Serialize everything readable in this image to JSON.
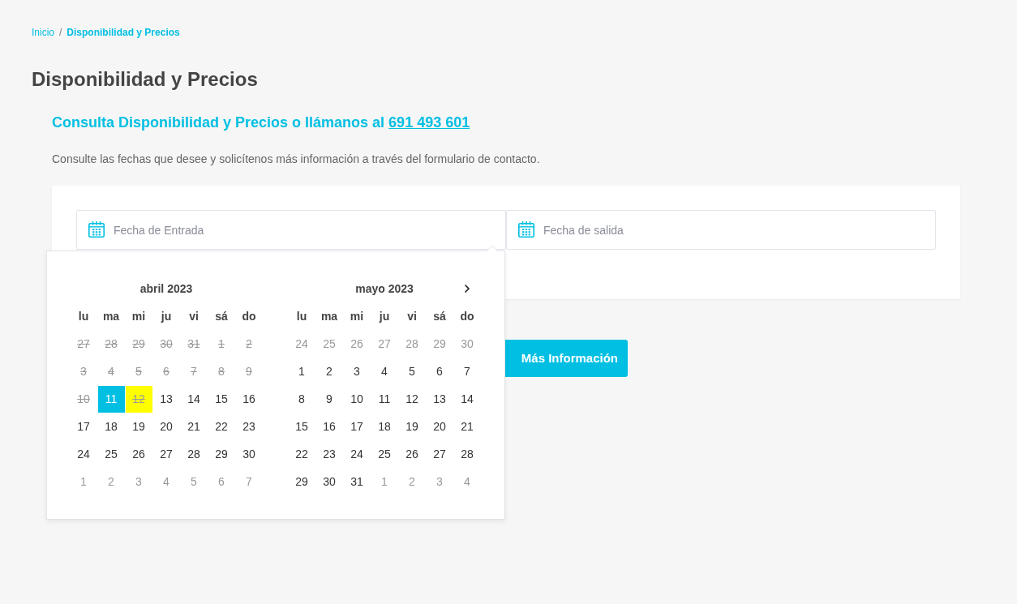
{
  "breadcrumb": {
    "separator": "/",
    "items": [
      {
        "label": "Inicio",
        "current": false
      },
      {
        "label": "Disponibilidad y Precios",
        "current": true
      }
    ]
  },
  "title": "Disponibilidad y Precios",
  "contact_heading": {
    "text": "Consulta Disponibilidad y Precios o llámanos al",
    "phone": "691 493 601"
  },
  "intro": "Consulte las fechas que desee y solicítenos más información a través del formulario de contacto.",
  "date_fields": [
    {
      "placeholder": "Fecha de Entrada"
    },
    {
      "placeholder": "Fecha de salida"
    }
  ],
  "submit_button": {
    "label": "Más Información"
  },
  "datepicker": {
    "months": [
      {
        "title": "abril 2023",
        "next_arrow": false,
        "weekdays": [
          "lu",
          "ma",
          "mi",
          "ju",
          "vi",
          "sá",
          "do"
        ],
        "weeks": [
          [
            {
              "label": "27",
              "greyed": true,
              "disabled": true,
              "selected": false,
              "today": false
            },
            {
              "label": "28",
              "greyed": true,
              "disabled": true,
              "selected": false,
              "today": false
            },
            {
              "label": "29",
              "greyed": true,
              "disabled": true,
              "selected": false,
              "today": false
            },
            {
              "label": "30",
              "greyed": true,
              "disabled": true,
              "selected": false,
              "today": false
            },
            {
              "label": "31",
              "greyed": true,
              "disabled": true,
              "selected": false,
              "today": false
            },
            {
              "label": "1",
              "greyed": true,
              "disabled": true,
              "selected": false,
              "today": false
            },
            {
              "label": "2",
              "greyed": true,
              "disabled": true,
              "selected": false,
              "today": false
            }
          ],
          [
            {
              "label": "3",
              "greyed": true,
              "disabled": true,
              "selected": false,
              "today": false
            },
            {
              "label": "4",
              "greyed": true,
              "disabled": true,
              "selected": false,
              "today": false
            },
            {
              "label": "5",
              "greyed": true,
              "disabled": true,
              "selected": false,
              "today": false
            },
            {
              "label": "6",
              "greyed": true,
              "disabled": true,
              "selected": false,
              "today": false
            },
            {
              "label": "7",
              "greyed": true,
              "disabled": true,
              "selected": false,
              "today": false
            },
            {
              "label": "8",
              "greyed": true,
              "disabled": true,
              "selected": false,
              "today": false
            },
            {
              "label": "9",
              "greyed": true,
              "disabled": true,
              "selected": false,
              "today": false
            }
          ],
          [
            {
              "label": "10",
              "greyed": true,
              "disabled": true,
              "selected": false,
              "today": false
            },
            {
              "label": "11",
              "greyed": false,
              "disabled": false,
              "selected": true,
              "today": false
            },
            {
              "label": "12",
              "greyed": true,
              "disabled": true,
              "selected": false,
              "today": true
            },
            {
              "label": "13",
              "greyed": false,
              "disabled": false,
              "selected": false,
              "today": false
            },
            {
              "label": "14",
              "greyed": false,
              "disabled": false,
              "selected": false,
              "today": false
            },
            {
              "label": "15",
              "greyed": false,
              "disabled": false,
              "selected": false,
              "today": false
            },
            {
              "label": "16",
              "greyed": false,
              "disabled": false,
              "selected": false,
              "today": false
            }
          ],
          [
            {
              "label": "17",
              "greyed": false,
              "disabled": false,
              "selected": false,
              "today": false
            },
            {
              "label": "18",
              "greyed": false,
              "disabled": false,
              "selected": false,
              "today": false
            },
            {
              "label": "19",
              "greyed": false,
              "disabled": false,
              "selected": false,
              "today": false
            },
            {
              "label": "20",
              "greyed": false,
              "disabled": false,
              "selected": false,
              "today": false
            },
            {
              "label": "21",
              "greyed": false,
              "disabled": false,
              "selected": false,
              "today": false
            },
            {
              "label": "22",
              "greyed": false,
              "disabled": false,
              "selected": false,
              "today": false
            },
            {
              "label": "23",
              "greyed": false,
              "disabled": false,
              "selected": false,
              "today": false
            }
          ],
          [
            {
              "label": "24",
              "greyed": false,
              "disabled": false,
              "selected": false,
              "today": false
            },
            {
              "label": "25",
              "greyed": false,
              "disabled": false,
              "selected": false,
              "today": false
            },
            {
              "label": "26",
              "greyed": false,
              "disabled": false,
              "selected": false,
              "today": false
            },
            {
              "label": "27",
              "greyed": false,
              "disabled": false,
              "selected": false,
              "today": false
            },
            {
              "label": "28",
              "greyed": false,
              "disabled": false,
              "selected": false,
              "today": false
            },
            {
              "label": "29",
              "greyed": false,
              "disabled": false,
              "selected": false,
              "today": false
            },
            {
              "label": "30",
              "greyed": false,
              "disabled": false,
              "selected": false,
              "today": false
            }
          ],
          [
            {
              "label": "1",
              "greyed": true,
              "disabled": false,
              "selected": false,
              "today": false
            },
            {
              "label": "2",
              "greyed": true,
              "disabled": false,
              "selected": false,
              "today": false
            },
            {
              "label": "3",
              "greyed": true,
              "disabled": false,
              "selected": false,
              "today": false
            },
            {
              "label": "4",
              "greyed": true,
              "disabled": false,
              "selected": false,
              "today": false
            },
            {
              "label": "5",
              "greyed": true,
              "disabled": false,
              "selected": false,
              "today": false
            },
            {
              "label": "6",
              "greyed": true,
              "disabled": false,
              "selected": false,
              "today": false
            },
            {
              "label": "7",
              "greyed": true,
              "disabled": false,
              "selected": false,
              "today": false
            }
          ]
        ]
      },
      {
        "title": "mayo 2023",
        "next_arrow": true,
        "weekdays": [
          "lu",
          "ma",
          "mi",
          "ju",
          "vi",
          "sá",
          "do"
        ],
        "weeks": [
          [
            {
              "label": "24",
              "greyed": true,
              "disabled": false,
              "selected": false,
              "today": false
            },
            {
              "label": "25",
              "greyed": true,
              "disabled": false,
              "selected": false,
              "today": false
            },
            {
              "label": "26",
              "greyed": true,
              "disabled": false,
              "selected": false,
              "today": false
            },
            {
              "label": "27",
              "greyed": true,
              "disabled": false,
              "selected": false,
              "today": false
            },
            {
              "label": "28",
              "greyed": true,
              "disabled": false,
              "selected": false,
              "today": false
            },
            {
              "label": "29",
              "greyed": true,
              "disabled": false,
              "selected": false,
              "today": false
            },
            {
              "label": "30",
              "greyed": true,
              "disabled": false,
              "selected": false,
              "today": false
            }
          ],
          [
            {
              "label": "1",
              "greyed": false,
              "disabled": false,
              "selected": false,
              "today": false
            },
            {
              "label": "2",
              "greyed": false,
              "disabled": false,
              "selected": false,
              "today": false
            },
            {
              "label": "3",
              "greyed": false,
              "disabled": false,
              "selected": false,
              "today": false
            },
            {
              "label": "4",
              "greyed": false,
              "disabled": false,
              "selected": false,
              "today": false
            },
            {
              "label": "5",
              "greyed": false,
              "disabled": false,
              "selected": false,
              "today": false
            },
            {
              "label": "6",
              "greyed": false,
              "disabled": false,
              "selected": false,
              "today": false
            },
            {
              "label": "7",
              "greyed": false,
              "disabled": false,
              "selected": false,
              "today": false
            }
          ],
          [
            {
              "label": "8",
              "greyed": false,
              "disabled": false,
              "selected": false,
              "today": false
            },
            {
              "label": "9",
              "greyed": false,
              "disabled": false,
              "selected": false,
              "today": false
            },
            {
              "label": "10",
              "greyed": false,
              "disabled": false,
              "selected": false,
              "today": false
            },
            {
              "label": "11",
              "greyed": false,
              "disabled": false,
              "selected": false,
              "today": false
            },
            {
              "label": "12",
              "greyed": false,
              "disabled": false,
              "selected": false,
              "today": false
            },
            {
              "label": "13",
              "greyed": false,
              "disabled": false,
              "selected": false,
              "today": false
            },
            {
              "label": "14",
              "greyed": false,
              "disabled": false,
              "selected": false,
              "today": false
            }
          ],
          [
            {
              "label": "15",
              "greyed": false,
              "disabled": false,
              "selected": false,
              "today": false
            },
            {
              "label": "16",
              "greyed": false,
              "disabled": false,
              "selected": false,
              "today": false
            },
            {
              "label": "17",
              "greyed": false,
              "disabled": false,
              "selected": false,
              "today": false
            },
            {
              "label": "18",
              "greyed": false,
              "disabled": false,
              "selected": false,
              "today": false
            },
            {
              "label": "19",
              "greyed": false,
              "disabled": false,
              "selected": false,
              "today": false
            },
            {
              "label": "20",
              "greyed": false,
              "disabled": false,
              "selected": false,
              "today": false
            },
            {
              "label": "21",
              "greyed": false,
              "disabled": false,
              "selected": false,
              "today": false
            }
          ],
          [
            {
              "label": "22",
              "greyed": false,
              "disabled": false,
              "selected": false,
              "today": false
            },
            {
              "label": "23",
              "greyed": false,
              "disabled": false,
              "selected": false,
              "today": false
            },
            {
              "label": "24",
              "greyed": false,
              "disabled": false,
              "selected": false,
              "today": false
            },
            {
              "label": "25",
              "greyed": false,
              "disabled": false,
              "selected": false,
              "today": false
            },
            {
              "label": "26",
              "greyed": false,
              "disabled": false,
              "selected": false,
              "today": false
            },
            {
              "label": "27",
              "greyed": false,
              "disabled": false,
              "selected": false,
              "today": false
            },
            {
              "label": "28",
              "greyed": false,
              "disabled": false,
              "selected": false,
              "today": false
            }
          ],
          [
            {
              "label": "29",
              "greyed": false,
              "disabled": false,
              "selected": false,
              "today": false
            },
            {
              "label": "30",
              "greyed": false,
              "disabled": false,
              "selected": false,
              "today": false
            },
            {
              "label": "31",
              "greyed": false,
              "disabled": false,
              "selected": false,
              "today": false
            },
            {
              "label": "1",
              "greyed": true,
              "disabled": false,
              "selected": false,
              "today": false
            },
            {
              "label": "2",
              "greyed": true,
              "disabled": false,
              "selected": false,
              "today": false
            },
            {
              "label": "3",
              "greyed": true,
              "disabled": false,
              "selected": false,
              "today": false
            },
            {
              "label": "4",
              "greyed": true,
              "disabled": false,
              "selected": false,
              "today": false
            }
          ]
        ]
      }
    ]
  }
}
